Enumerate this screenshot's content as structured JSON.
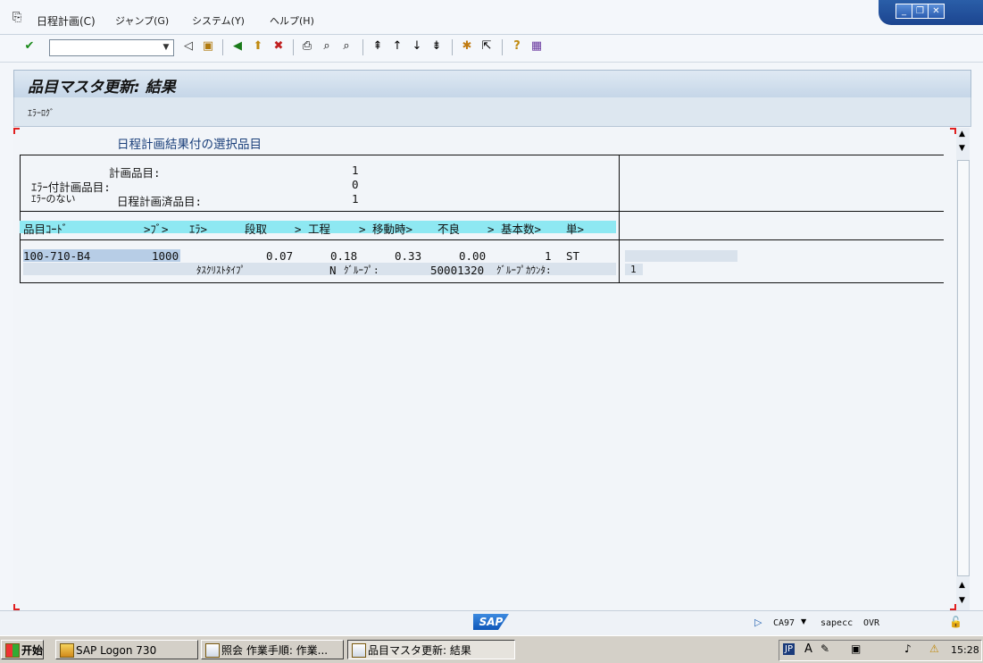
{
  "menu": {
    "items": [
      {
        "label": "日程計画(C)"
      },
      {
        "label": "ジャンプ(G)"
      },
      {
        "label": "システム(Y)"
      },
      {
        "label": "ヘルプ(H)"
      }
    ]
  },
  "window_controls": {
    "minimize": "_",
    "restore": "❐",
    "close": "✕"
  },
  "toolbar": {
    "command_value": ""
  },
  "title": "品目マスタ更新: 結果",
  "app_toolbar": {
    "error_log": "ｴﾗｰﾛｸﾞ"
  },
  "section_title": "日程計画結果付の選択品目",
  "summary": {
    "planned_label": "計画品目:",
    "planned_value": "1",
    "error_label": "ｴﾗｰ付計画品目:",
    "error_value": "0",
    "ok_label_a": "ｴﾗｰのない",
    "ok_label_b": "日程計画済品目:",
    "ok_value": "1"
  },
  "columns": [
    "品目ｺｰﾄﾞ",
    ">ﾌﾞ>",
    "ｴﾗ>",
    "段取",
    "> 工程",
    "> 移動時>",
    "不良",
    "> 基本数>",
    "単>"
  ],
  "row": {
    "material": "100-710-B4",
    "plant": "1000",
    "setup": "0.07",
    "process": "0.18",
    "move": "0.33",
    "scrap": "0.00",
    "base_qty": "1",
    "unit": "ST",
    "tasklist_label": "ﾀｽｸﾘｽﾄﾀｲﾌﾟ",
    "tasklist_value": "N",
    "group_label": "ｸﾞﾙｰﾌﾟ:",
    "group_value": "50001320",
    "counter_label": "ｸﾞﾙｰﾌﾟｶｳﾝﾀ:",
    "counter_value": "1"
  },
  "status": {
    "system": "CA97",
    "server": "sapecc",
    "mode": "OVR"
  },
  "taskbar": {
    "start": "开始",
    "tasks": [
      {
        "label": "SAP Logon 730"
      },
      {
        "label": "照会 作業手順: 作業..."
      },
      {
        "label": "品目マスタ更新: 結果"
      }
    ],
    "tray_lang": "JP",
    "clock": "15:28"
  }
}
